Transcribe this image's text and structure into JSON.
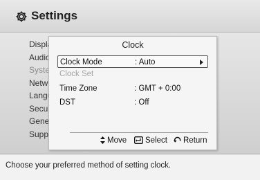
{
  "header": {
    "title": "Settings",
    "icon": "gear-icon"
  },
  "menu": {
    "items": [
      {
        "label": "Display"
      },
      {
        "label": "Audio"
      },
      {
        "label": "System"
      },
      {
        "label": "Network"
      },
      {
        "label": "Language"
      },
      {
        "label": "Security"
      },
      {
        "label": "General"
      },
      {
        "label": "Support"
      }
    ]
  },
  "dialog": {
    "title": "Clock",
    "options": [
      {
        "label": "Clock Mode",
        "value": ": Auto",
        "state": "selected"
      },
      {
        "label": "Clock Set",
        "value": "",
        "state": "disabled"
      },
      {
        "label": "Time Zone",
        "value": ": GMT + 0:00",
        "state": "normal"
      },
      {
        "label": "DST",
        "value": ": Off",
        "state": "normal"
      }
    ],
    "hints": {
      "move": "Move",
      "select": "Select",
      "return": "Return"
    }
  },
  "footer": {
    "help": "Choose your preferred method of setting clock."
  }
}
